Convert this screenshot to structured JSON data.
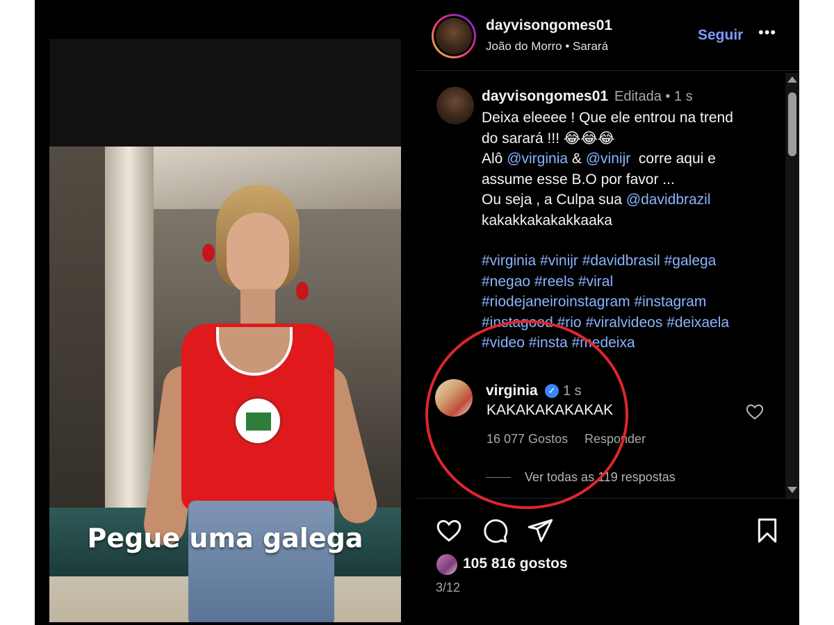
{
  "media": {
    "overlay_caption": "Pegue uma galega"
  },
  "post_header": {
    "username": "dayvisongomes01",
    "location": "João do Morro • Sarará",
    "follow_label": "Seguir",
    "more_icon": "more-options-icon"
  },
  "caption": {
    "username": "dayvisongomes01",
    "meta": "Editada • 1 s",
    "line1": "Deixa eleeee ! Que ele entrou na trend",
    "line2": "do sarará !!! 😂😂😂",
    "line3_prefix": "Alô ",
    "mention1": "@virginia",
    "line3_mid": " & ",
    "mention2": "@vinijr",
    "line3_suffix": "  corre aqui e",
    "line4": "assume esse B.O por favor ...",
    "line5_prefix": "Ou seja , a Culpa sua ",
    "mention3": "@davidbrazil",
    "line6": "kakakkakakakkaaka",
    "hashtags": [
      "#virginia #vinijr #davidbrasil #galega",
      "#negao #reels #viral",
      "#riodejaneiroinstagram #instagram",
      "#instagood #rio #viralvideos #deixaela",
      "#video #insta #medeixa"
    ]
  },
  "reply": {
    "username": "virginia",
    "time": "1 s",
    "text": "KAKAKAKAKAKAK",
    "likes": "16 077 Gostos",
    "reply_label": "Responder",
    "view_replies": "Ver todas as 119 respostas"
  },
  "actions": {
    "likes_total": "105 816 gostos",
    "counter": "3/12"
  },
  "colors": {
    "accent_link": "#8ab4ff",
    "follow": "#7b9cff",
    "annotation": "#e0262b",
    "verified": "#3a86ff"
  }
}
